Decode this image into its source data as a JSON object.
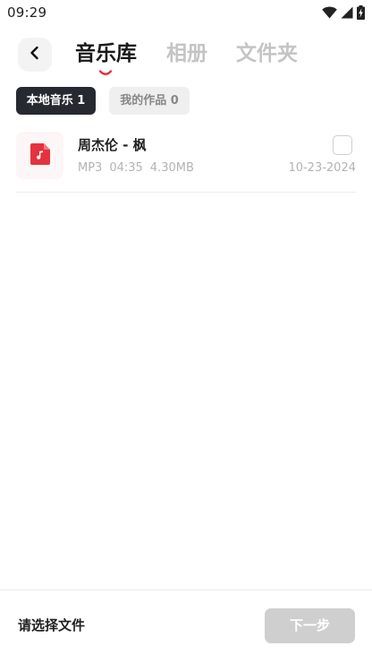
{
  "status_bar": {
    "time": "09:29",
    "icons": [
      "wifi-icon",
      "cellular-signal-icon",
      "battery-charging-icon"
    ]
  },
  "header": {
    "back_icon": "chevron-left-icon",
    "tabs": [
      {
        "label": "音乐库",
        "active": true
      },
      {
        "label": "相册",
        "active": false
      },
      {
        "label": "文件夹",
        "active": false
      }
    ]
  },
  "filters": {
    "chips": [
      {
        "label": "本地音乐 1",
        "active": true
      },
      {
        "label": "我的作品 0",
        "active": false
      }
    ]
  },
  "files": [
    {
      "name": "周杰伦 - 枫",
      "format": "MP3",
      "duration": "04:35",
      "size": "4.30MB",
      "date": "10-23-2024",
      "icon": "music-file-icon",
      "checked": false
    }
  ],
  "footer": {
    "hint": "请选择文件",
    "next_label": "下一步"
  },
  "colors": {
    "accent": "#e5323f",
    "active_chip_bg": "#262a30",
    "inactive_text": "#c4c4c4",
    "disabled_button": "#cfcfcf"
  }
}
